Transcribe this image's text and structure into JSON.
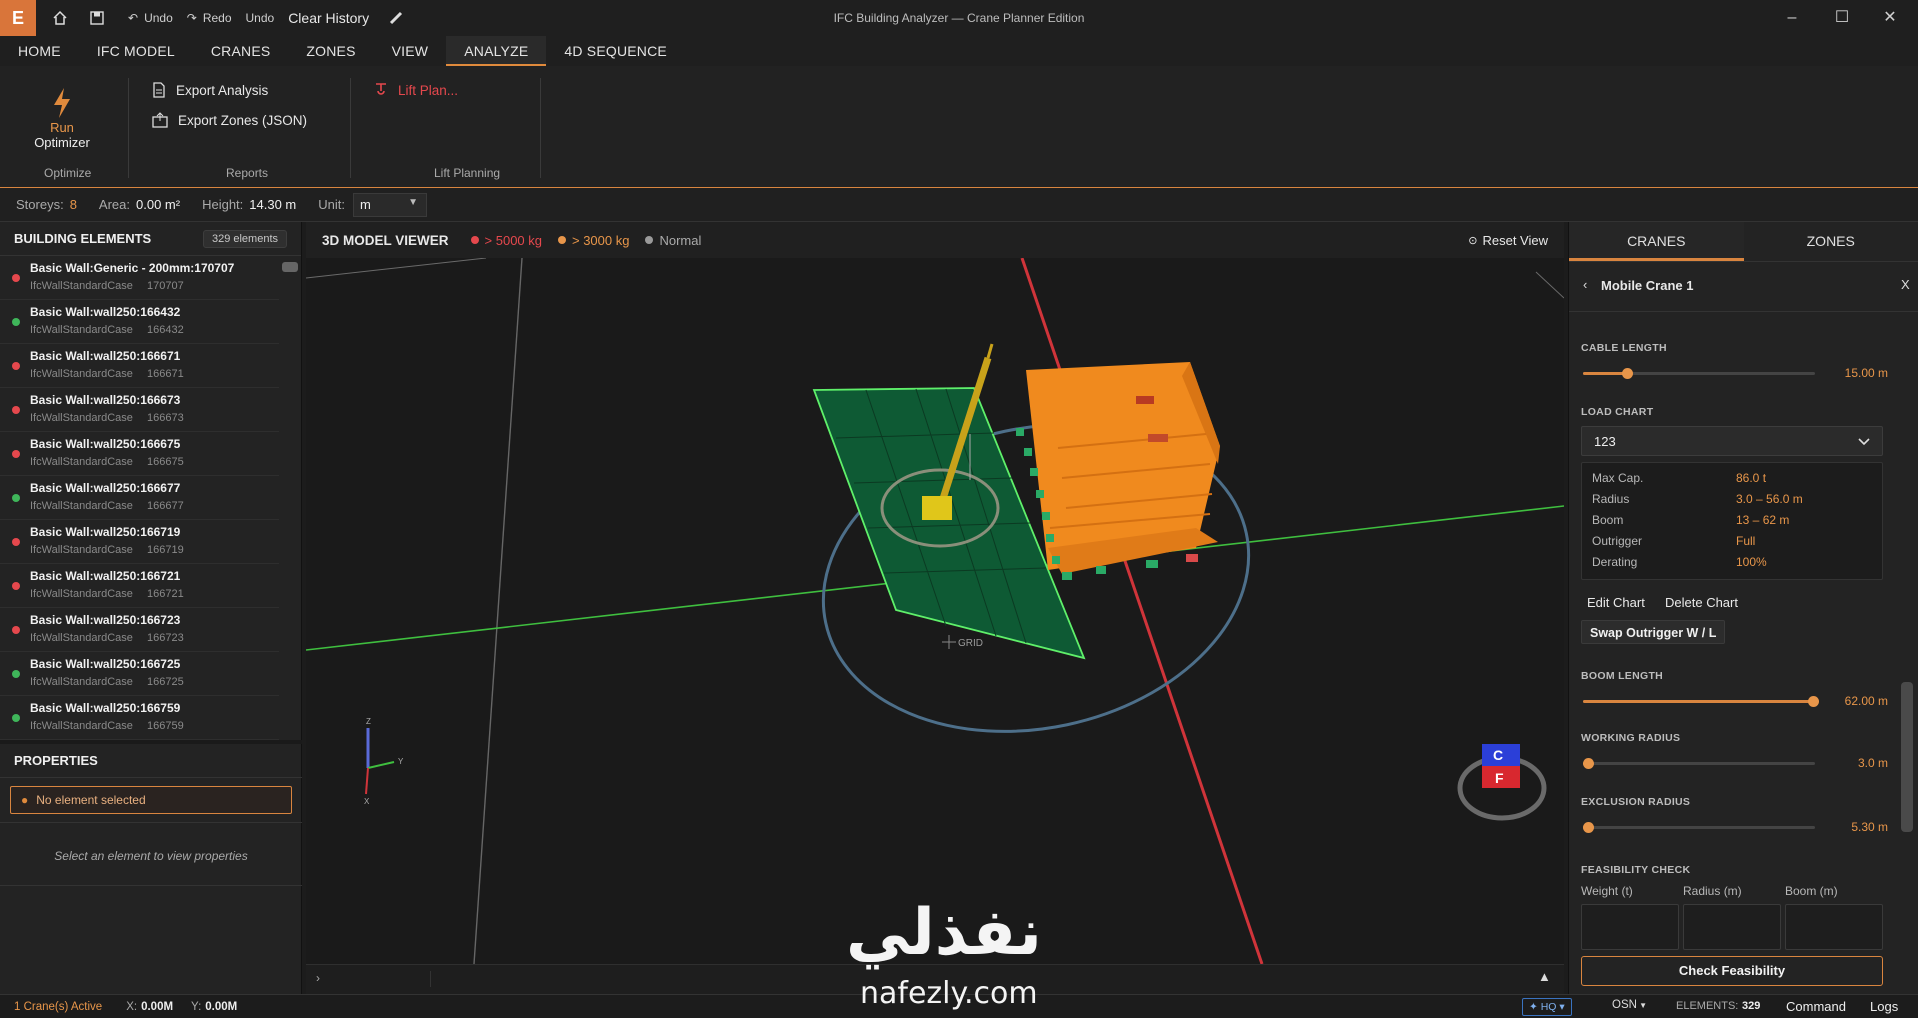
{
  "titlebar": {
    "logo": "E",
    "undo1": "Undo",
    "redo": "Redo",
    "undo2": "Undo",
    "clear_history": "Clear History",
    "window_title": "IFC Building Analyzer — Crane Planner Edition"
  },
  "menu": {
    "tabs": [
      "HOME",
      "IFC MODEL",
      "CRANES",
      "ZONES",
      "VIEW",
      "ANALYZE",
      "4D SEQUENCE"
    ],
    "active": "ANALYZE"
  },
  "ribbon": {
    "run_label": "Run",
    "optimizer_label": "Optimizer",
    "optimize_group": "Optimize",
    "export_analysis": "Export Analysis",
    "export_zones": "Export Zones (JSON)",
    "reports_group": "Reports",
    "lift_plan": "Lift Plan...",
    "lift_planning_group": "Lift Planning"
  },
  "infobar": {
    "storeys_label": "Storeys:",
    "storeys": "8",
    "area_label": "Area:",
    "area": "0.00 m²",
    "height_label": "Height:",
    "height": "14.30 m",
    "unit_label": "Unit:",
    "unit": "m"
  },
  "elements_panel": {
    "title": "BUILDING ELEMENTS",
    "count": "329 elements",
    "items": [
      {
        "name": "Basic Wall:Generic - 200mm:170707",
        "type": "IfcWallStandardCase",
        "id": "170707",
        "status": "red"
      },
      {
        "name": "Basic Wall:wall250:166432",
        "type": "IfcWallStandardCase",
        "id": "166432",
        "status": "green"
      },
      {
        "name": "Basic Wall:wall250:166671",
        "type": "IfcWallStandardCase",
        "id": "166671",
        "status": "red"
      },
      {
        "name": "Basic Wall:wall250:166673",
        "type": "IfcWallStandardCase",
        "id": "166673",
        "status": "red"
      },
      {
        "name": "Basic Wall:wall250:166675",
        "type": "IfcWallStandardCase",
        "id": "166675",
        "status": "red"
      },
      {
        "name": "Basic Wall:wall250:166677",
        "type": "IfcWallStandardCase",
        "id": "166677",
        "status": "green"
      },
      {
        "name": "Basic Wall:wall250:166719",
        "type": "IfcWallStandardCase",
        "id": "166719",
        "status": "red"
      },
      {
        "name": "Basic Wall:wall250:166721",
        "type": "IfcWallStandardCase",
        "id": "166721",
        "status": "red"
      },
      {
        "name": "Basic Wall:wall250:166723",
        "type": "IfcWallStandardCase",
        "id": "166723",
        "status": "red"
      },
      {
        "name": "Basic Wall:wall250:166725",
        "type": "IfcWallStandardCase",
        "id": "166725",
        "status": "green"
      },
      {
        "name": "Basic Wall:wall250:166759",
        "type": "IfcWallStandardCase",
        "id": "166759",
        "status": "green"
      }
    ]
  },
  "properties": {
    "title": "PROPERTIES",
    "no_selection": "No element selected",
    "hint": "Select an element to view properties"
  },
  "viewer": {
    "title": "3D MODEL VIEWER",
    "legend": [
      {
        "label": "> 5000 kg",
        "color": "#e5484d"
      },
      {
        "label": "> 3000 kg",
        "color": "#e8964a"
      },
      {
        "label": "Normal",
        "color": "#9a9a9a"
      }
    ],
    "reset_view": "Reset View",
    "grid_label": "GRID",
    "axis_x": "X",
    "axis_y": "Y",
    "axis_z": "Z",
    "cube_top": "C",
    "cube_front": "F",
    "footer_chevron": "›"
  },
  "right_panel": {
    "tabs": [
      "CRANES",
      "ZONES"
    ],
    "active_tab": "CRANES",
    "crane_name": "Mobile Crane 1",
    "close": "X",
    "cable_length_label": "CABLE LENGTH",
    "cable_length": "15.00 m",
    "cable_length_frac": 0.19,
    "load_chart_label": "LOAD CHART",
    "load_chart": "123",
    "chart_info": [
      {
        "key": "Max Cap.",
        "value": "86.0 t"
      },
      {
        "key": "Radius",
        "value": "3.0 – 56.0 m"
      },
      {
        "key": "Boom",
        "value": "13 – 62 m"
      },
      {
        "key": "Outrigger",
        "value": "Full"
      },
      {
        "key": "Derating",
        "value": "100%"
      }
    ],
    "edit_chart": "Edit Chart",
    "delete_chart": "Delete Chart",
    "swap_outrigger": "Swap Outrigger W / L",
    "boom_length_label": "BOOM LENGTH",
    "boom_length": "62.00 m",
    "boom_length_frac": 0.99,
    "working_radius_label": "WORKING RADIUS",
    "working_radius": "3.0 m",
    "working_radius_frac": 0.02,
    "exclusion_radius_label": "EXCLUSION RADIUS",
    "exclusion_radius": "5.30 m",
    "exclusion_radius_frac": 0.02,
    "feasibility_label": "FEASIBILITY CHECK",
    "weight_label": "Weight (t)",
    "radius_label": "Radius (m)",
    "boom_label": "Boom (m)",
    "check_button": "Check Feasibility"
  },
  "statusbar": {
    "cranes_active": "1 Crane(s) Active",
    "x_label": "X:",
    "x": "0.00M",
    "y_label": "Y:",
    "y": "0.00M",
    "hq": "HQ",
    "osn": "OSN",
    "elements_label": "ELEMENTS:",
    "elements": "329",
    "command": "Command",
    "logs": "Logs"
  },
  "watermark": {
    "arabic": "نفذلي",
    "latin": "nafezly.com"
  },
  "colors": {
    "accent": "#d9853f",
    "danger": "#e5484d",
    "ok": "#3fb65a"
  }
}
